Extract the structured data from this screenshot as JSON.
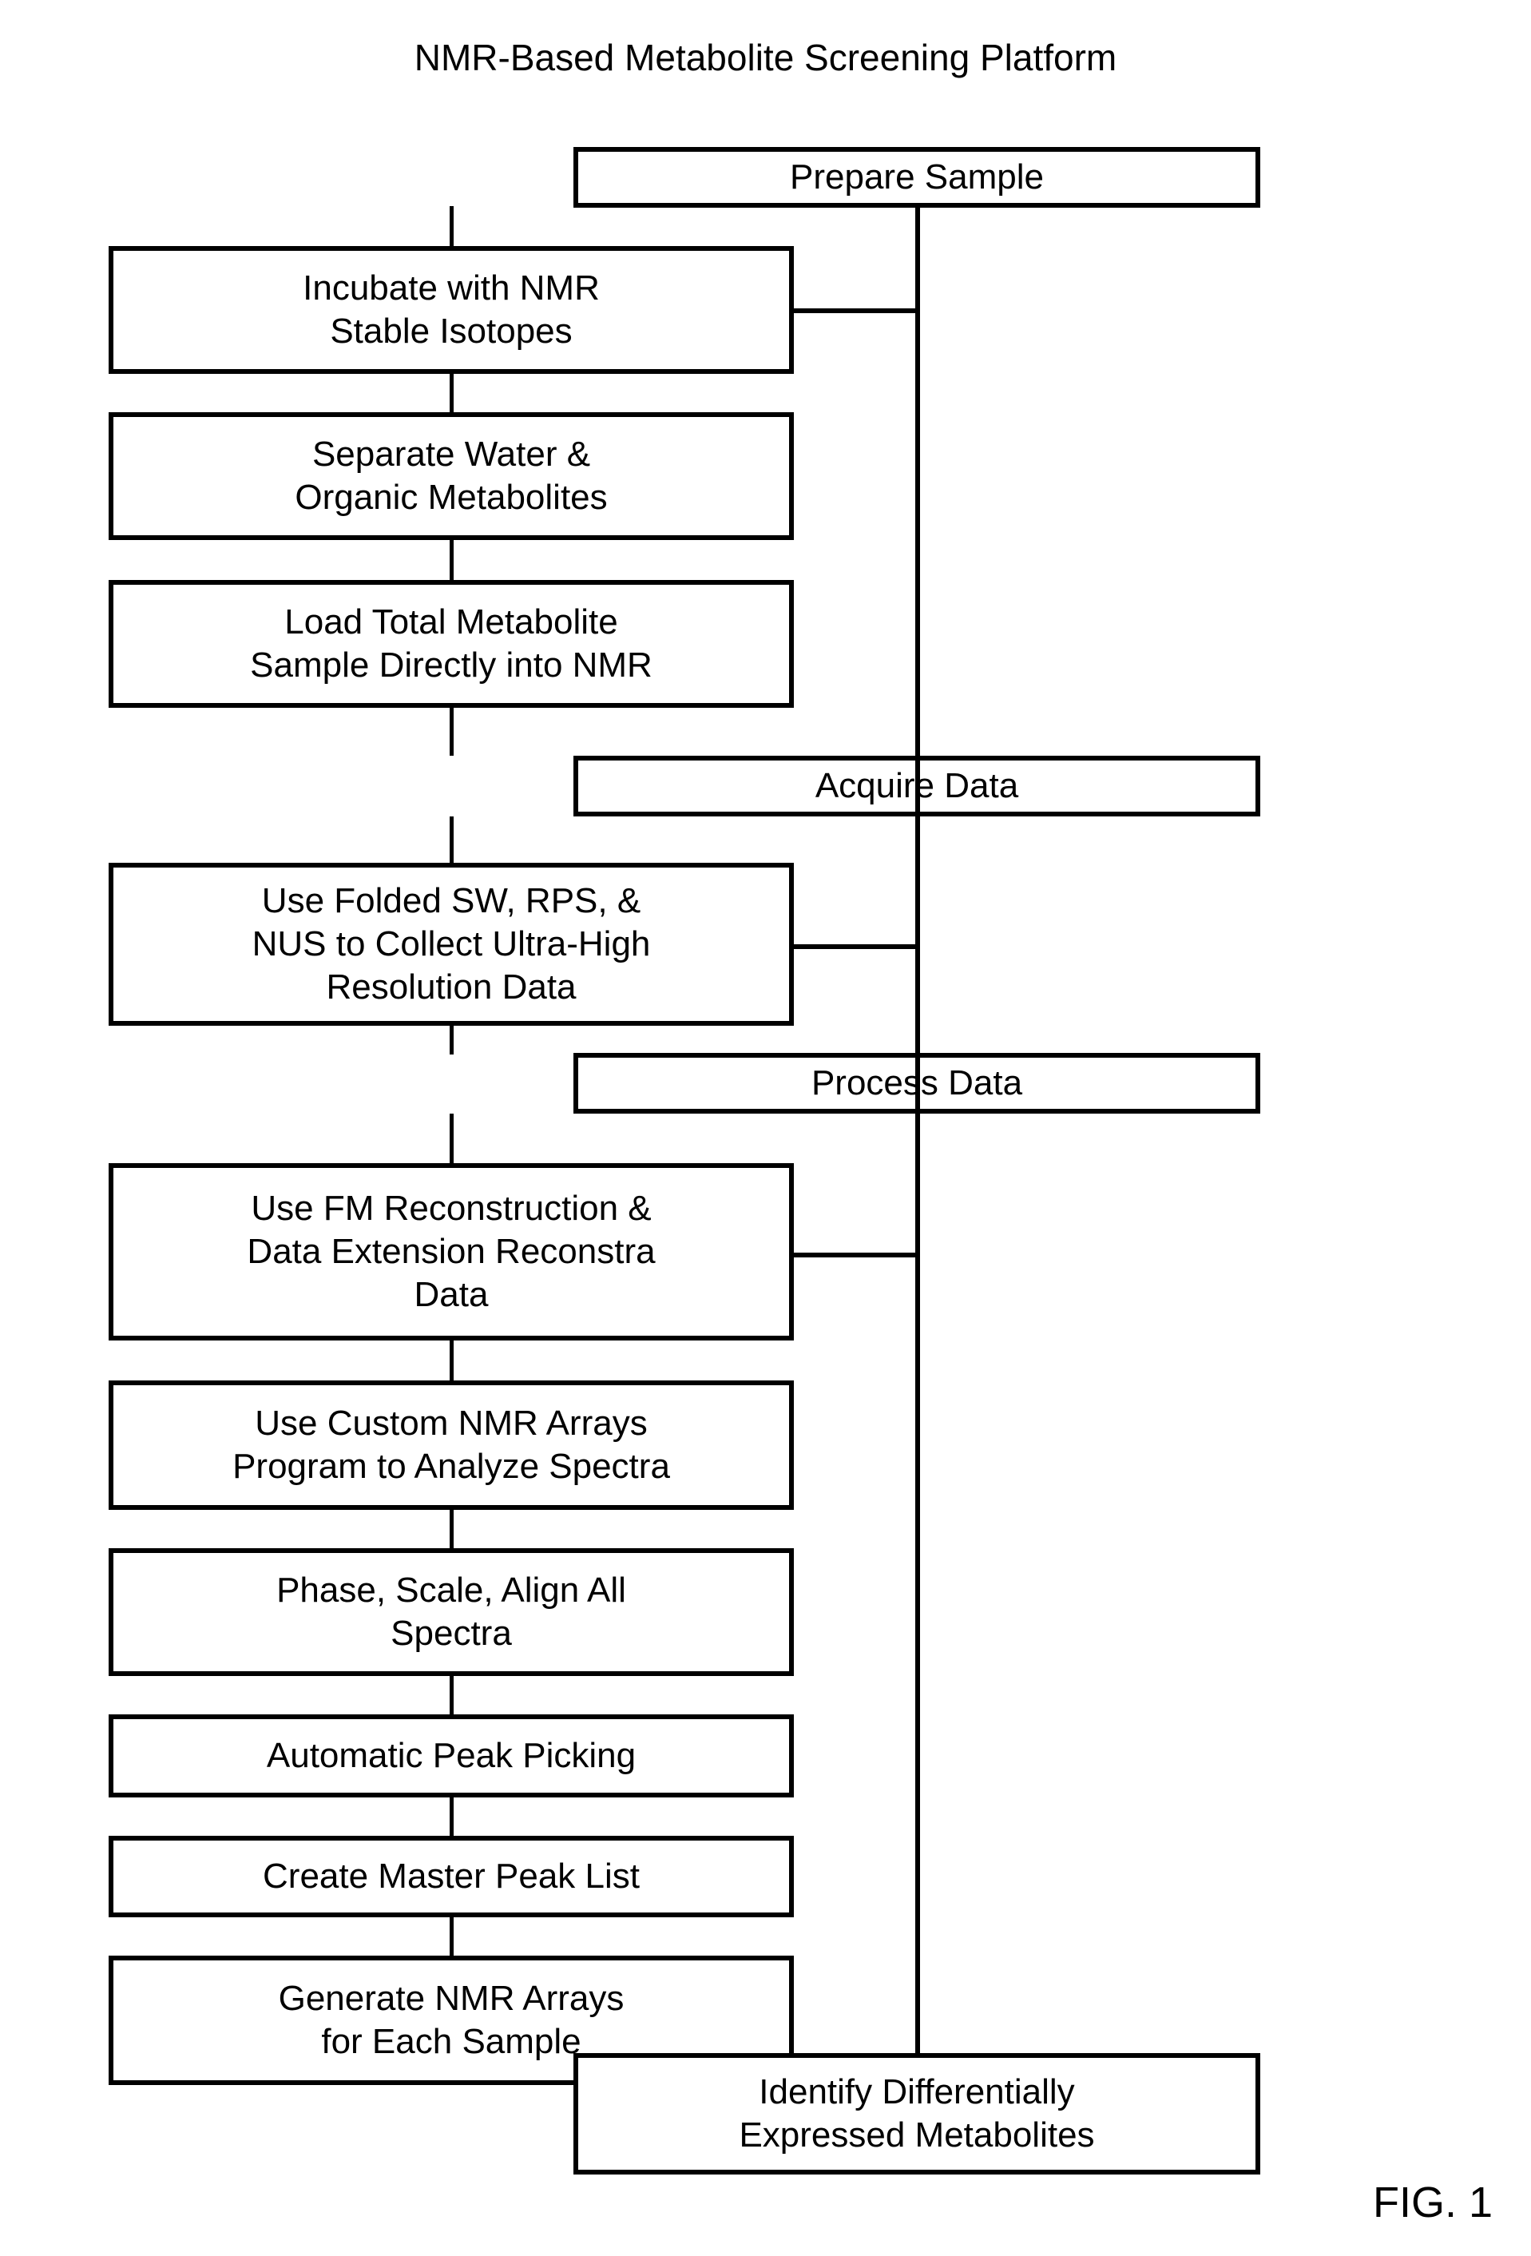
{
  "figure": {
    "title": "NMR-Based Metabolite Screening Platform",
    "number": "FIG. 1"
  },
  "diagram_data": {
    "type": "flowchart",
    "orientation": "vertical",
    "spine_description": "A single vertical line runs down the right-center of the figure linking the three stage boxes and the final outcome box; each detail box in the left column connects to this spine with a short horizontal stub.",
    "stages": [
      {
        "id": "prepare-sample",
        "label": "Prepare Sample",
        "steps": [
          "Incubate with NMR\nStable Isotopes",
          "Separate Water &\nOrganic Metabolites",
          "Load Total Metabolite\nSample Directly into NMR"
        ]
      },
      {
        "id": "acquire-data",
        "label": "Acquire Data",
        "steps": [
          "Use Folded SW, RPS, &\nNUS to Collect Ultra-High\nResolution Data"
        ]
      },
      {
        "id": "process-data",
        "label": "Process Data",
        "steps": [
          "Use FM Reconstruction &\nData Extension Reconstra\nData",
          "Use Custom NMR Arrays\nProgram to Analyze Spectra",
          "Phase, Scale, Align All\nSpectra",
          "Automatic Peak Picking",
          "Create Master Peak List",
          "Generate NMR Arrays\nfor Each Sample"
        ]
      }
    ],
    "outcome": {
      "id": "identify-metabolites",
      "label": "Identify Differentially\nExpressed Metabolites"
    }
  },
  "nodes": {
    "prepare_sample": "Prepare Sample",
    "incubate": "Incubate with NMR\nStable Isotopes",
    "separate": "Separate Water &\nOrganic Metabolites",
    "load": "Load Total Metabolite\nSample Directly into NMR",
    "acquire_data": "Acquire Data",
    "folded_sw": "Use Folded SW, RPS, &\nNUS to Collect Ultra-High\nResolution Data",
    "process_data": "Process Data",
    "fm_reconstruction": "Use FM Reconstruction &\nData Extension Reconstra\nData",
    "custom_arrays": "Use Custom NMR Arrays\nProgram to Analyze Spectra",
    "phase_scale": "Phase, Scale, Align All\nSpectra",
    "peak_picking": "Automatic Peak Picking",
    "master_peak_list": "Create Master Peak List",
    "generate_arrays": "Generate NMR Arrays\nfor Each Sample",
    "identify": "Identify Differentially\nExpressed Metabolites"
  },
  "colors": {
    "background": "#ffffff",
    "stroke": "#000000",
    "text": "#000000"
  }
}
